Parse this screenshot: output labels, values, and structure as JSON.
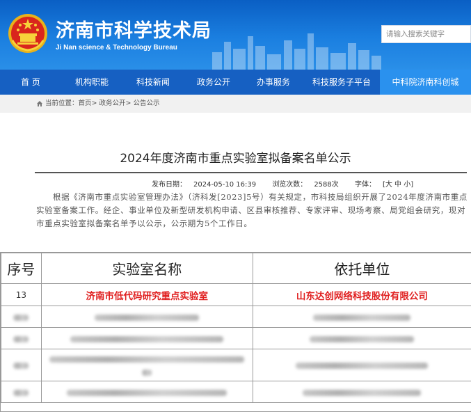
{
  "site": {
    "title": "济南市科学技术局",
    "subtitle": "Ji Nan science & Technology Bureau",
    "search_placeholder": "请输入搜索关键字"
  },
  "nav": {
    "items": [
      {
        "label": "首  页"
      },
      {
        "label": "机构职能"
      },
      {
        "label": "科技新闻"
      },
      {
        "label": "政务公开"
      },
      {
        "label": "办事服务"
      },
      {
        "label": "科技服务子平台"
      },
      {
        "label": "中科院济南科创城"
      }
    ]
  },
  "breadcrumb": {
    "text": "当前位置：首页> 政务公开> 公告公示"
  },
  "article": {
    "title": "2024年度济南市重点实验室拟备案名单公示",
    "publish_label": "发布日期：",
    "publish_date": "2024-05-10 16:39",
    "views_label": "浏览次数：",
    "views": "2588次",
    "font_label": "字体：",
    "font_sizes": "[大 中 小]",
    "body": "根据《济南市重点实验室管理办法》（济科发[2023]5号）有关规定，市科技局组织开展了2024年度济南市重点实验室备案工作。经企、事业单位及新型研发机构申请、区县审核推荐、专家评审、现场考察、局党组会研究，现对市重点实验室拟备案名单予以公示，公示期为5个工作日。"
  },
  "table": {
    "headers": [
      "序号",
      "实验室名称",
      "依托单位"
    ],
    "highlight_row": {
      "no": "13",
      "name": "济南市低代码研究重点实验室",
      "org": "山东达创网络科技股份有限公司"
    }
  },
  "colors": {
    "header_blue": "#1b7fe0",
    "nav_blue": "#1660c2",
    "nav_special": "#2a91ee",
    "highlight_red": "#e02020"
  }
}
